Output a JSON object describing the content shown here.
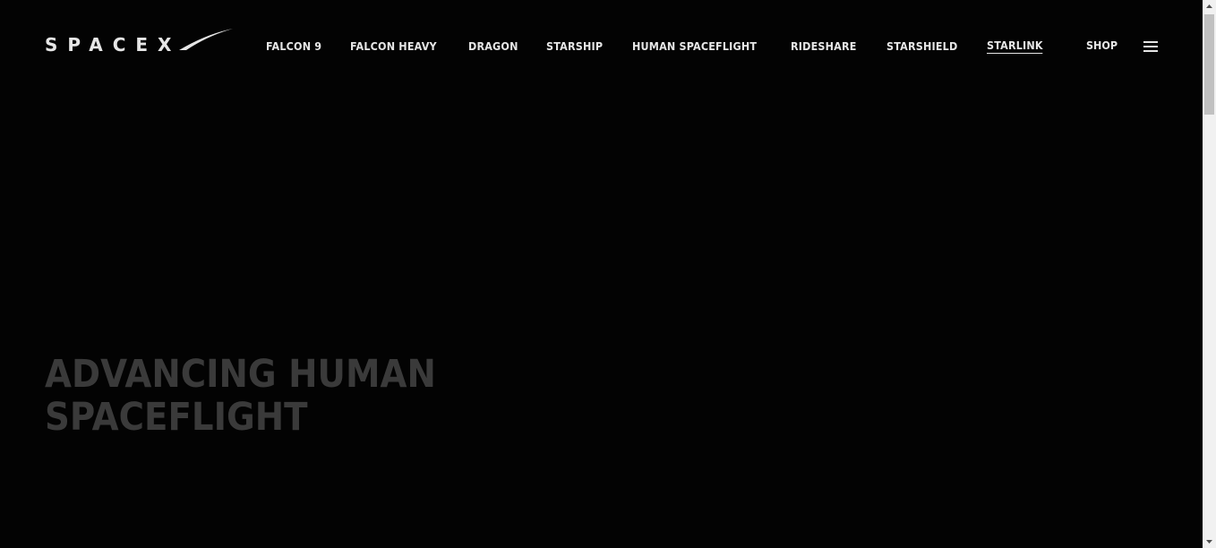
{
  "header": {
    "logo_text": "SPACEX",
    "nav": [
      {
        "label": "FALCON 9",
        "active": false
      },
      {
        "label": "FALCON HEAVY",
        "active": false
      },
      {
        "label": "DRAGON",
        "active": false
      },
      {
        "label": "STARSHIP",
        "active": false
      },
      {
        "label": "HUMAN SPACEFLIGHT",
        "active": false
      },
      {
        "label": "RIDESHARE",
        "active": false
      },
      {
        "label": "STARSHIELD",
        "active": false
      },
      {
        "label": "STARLINK",
        "active": true
      }
    ],
    "shop_label": "SHOP",
    "menu_icon": "hamburger-menu-icon"
  },
  "hero": {
    "title_line1": "ADVANCING HUMAN",
    "title_line2": "SPACEFLIGHT"
  },
  "scrollbar": {
    "scroll_position": 0
  },
  "colors": {
    "background": "#030303",
    "nav_text": "#e6e6e6",
    "hero_text": "#3a3a3a",
    "scrollbar_track": "#f1f1f1",
    "scrollbar_thumb": "#c1c1c1"
  }
}
